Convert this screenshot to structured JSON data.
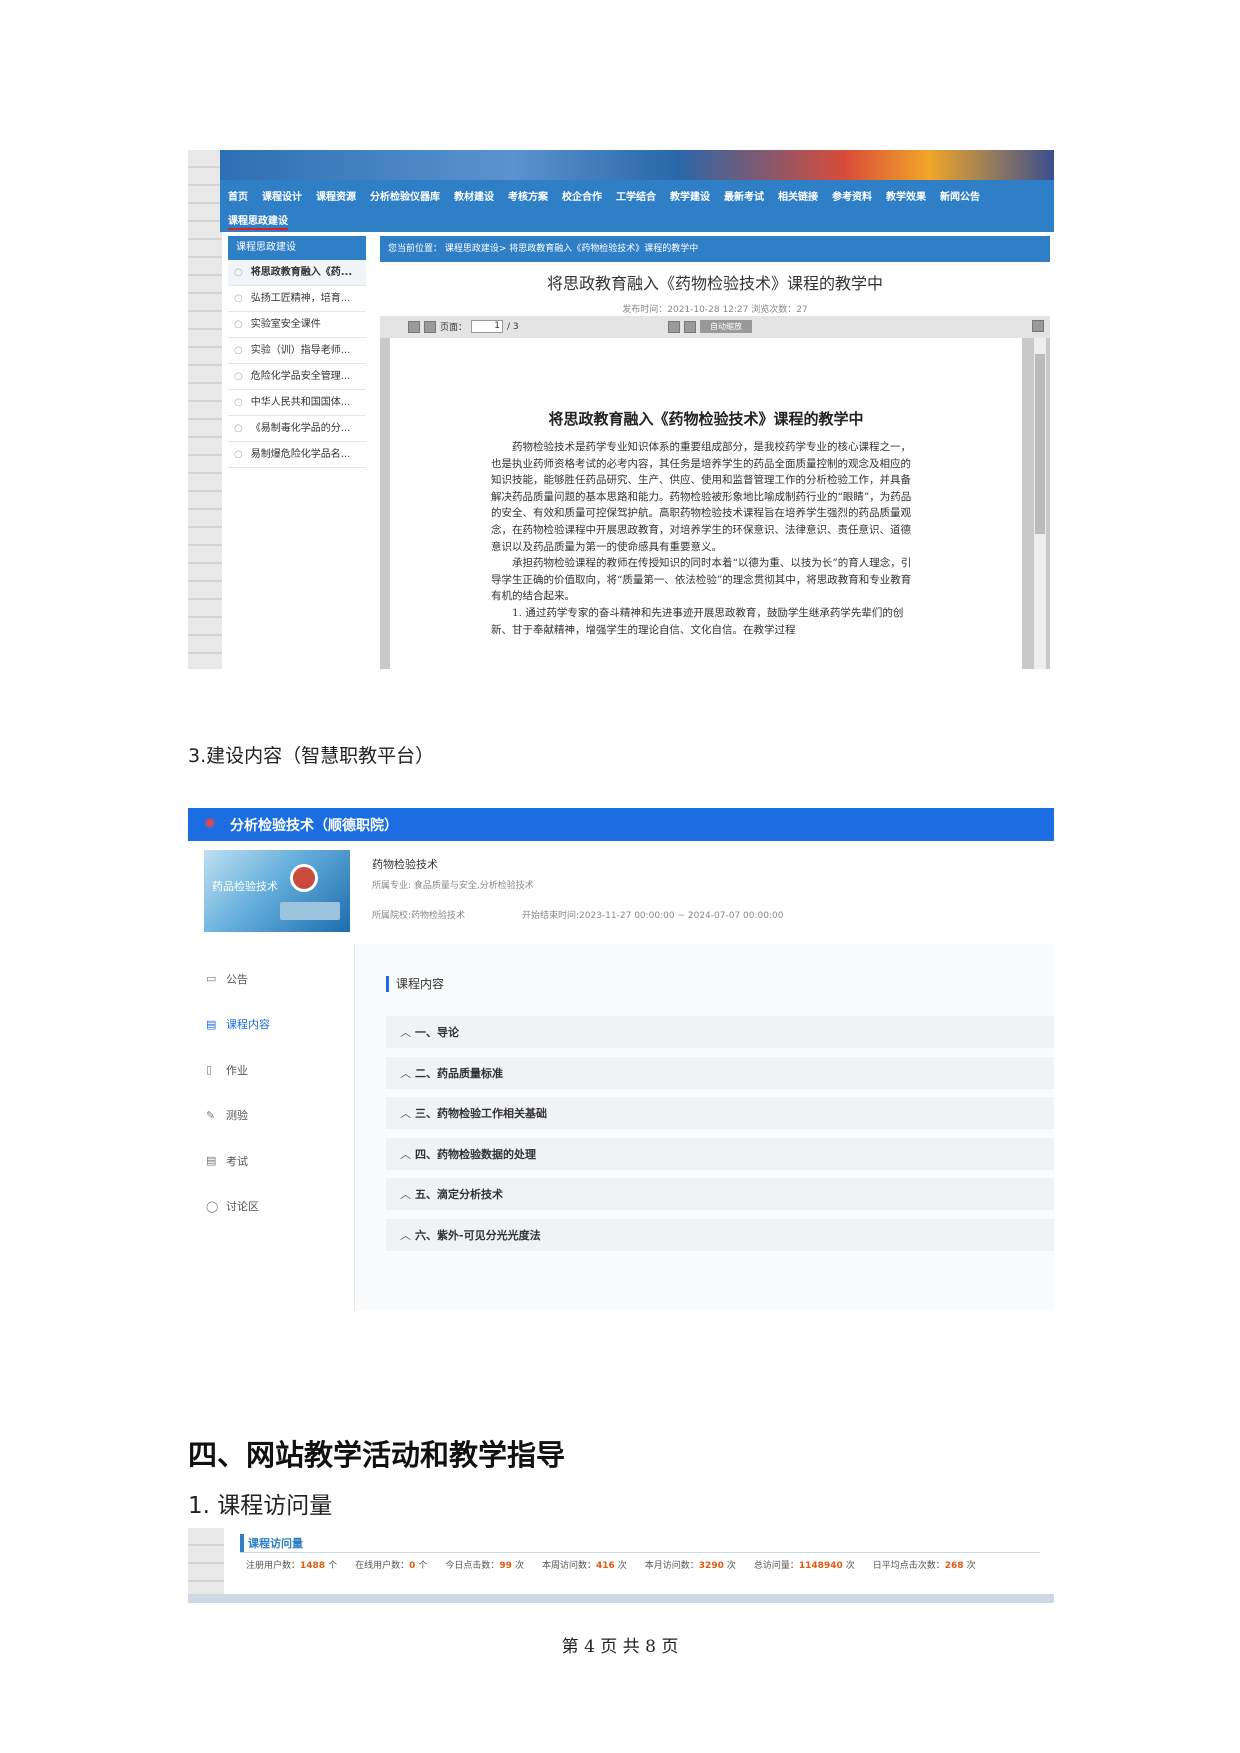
{
  "shot1": {
    "nav_items": [
      "首页",
      "课程设计",
      "课程资源",
      "分析检验仪器库",
      "教材建设",
      "考核方案",
      "校企合作",
      "工学结合",
      "教学建设",
      "最新考试",
      "相关链接",
      "参考资料",
      "教学效果",
      "新闻公告"
    ],
    "nav_sub": "课程思政建设",
    "side_header": "课程思政建设",
    "side_items": [
      "将思政教育融入《药...",
      "弘扬工匠精神，培育...",
      "实验室安全课件",
      "实验（训）指导老师...",
      "危险化学品安全管理...",
      "中华人民共和国国体...",
      "《易制毒化学品的分...",
      "易制爆危险化学品名..."
    ],
    "breadcrumb": "您当前位置： 课程思政建设> 将思政教育融入《药物检验技术》课程的教学中",
    "article_title": "将思政教育融入《药物检验技术》课程的教学中",
    "article_meta": "发布时间：2021-10-28 12:27 浏览次数：27",
    "viewer": {
      "page_label": "页面：",
      "page_current": "1",
      "page_total": "/ 3",
      "zoom_label": "自动缩放"
    },
    "doc_title": "将思政教育融入《药物检验技术》课程的教学中",
    "doc_paragraphs": [
      "药物检验技术是药学专业知识体系的重要组成部分，是我校药学专业的核心课程之一，也是执业药师资格考试的必考内容，其任务是培养学生的药品全面质量控制的观念及相应的知识技能，能够胜任药品研究、生产、供应、使用和监督管理工作的分析检验工作，并具备解决药品质量问题的基本思路和能力。药物检验被形象地比喻成制药行业的“眼睛”，为药品的安全、有效和质量可控保驾护航。高职药物检验技术课程旨在培养学生强烈的药品质量观念，在药物检验课程中开展思政教育，对培养学生的环保意识、法律意识、责任意识、道德意识以及药品质量为第一的使命感具有重要意义。",
      "承担药物检验课程的教师在传授知识的同时本着“以德为重、以技为长”的育人理念，引导学生正确的价值取向，将“质量第一、依法检验”的理念贯彻其中，将思政教育和专业教育有机的结合起来。",
      "1. 通过药学专家的奋斗精神和先进事迹开展思政教育，鼓励学生继承药学先辈们的创新、甘于奉献精神，增强学生的理论自信、文化自信。在教学过程"
    ]
  },
  "heading_build": "3.建设内容（智慧职教平台）",
  "shot2": {
    "app_title": "分析检验技术（顺德职院）",
    "cover_text": "药品检验技术",
    "course_name": "药物检验技术",
    "major": "所属专业: 食品质量与安全,分析检验技术",
    "school": "所属院校:药物检验技术",
    "time": "开始结束时间:2023-11-27 00:00:00 ~ 2024-07-07 00:00:00",
    "side_items": [
      {
        "icon": "▭",
        "label": "公告"
      },
      {
        "icon": "▤",
        "label": "课程内容"
      },
      {
        "icon": "▯",
        "label": "作业"
      },
      {
        "icon": "✎",
        "label": "测验"
      },
      {
        "icon": "▤",
        "label": "考试"
      },
      {
        "icon": "◯",
        "label": "讨论区"
      }
    ],
    "panel_header": "课程内容",
    "chapters": [
      "一、导论",
      "二、药品质量标准",
      "三、药物检验工作相关基础",
      "四、药物检验数据的处理",
      "五、滴定分析技术",
      "六、紫外-可见分光光度法"
    ]
  },
  "section_four": "四、网站教学活动和教学指导",
  "sub_one": "1.  课程访问量",
  "shot3": {
    "header": "课程访问量",
    "stats": [
      {
        "label": "注册用户数：",
        "value": "1488",
        "unit": "个"
      },
      {
        "label": "在线用户数：",
        "value": "0",
        "unit": "个"
      },
      {
        "label": "今日点击数：",
        "value": "99",
        "unit": "次"
      },
      {
        "label": "本周访问数：",
        "value": "416",
        "unit": "次"
      },
      {
        "label": "本月访问数：",
        "value": "3290",
        "unit": "次"
      },
      {
        "label": "总访问量：",
        "value": "1148940",
        "unit": "次"
      },
      {
        "label": "日平均点击次数：",
        "value": "268",
        "unit": "次"
      }
    ]
  },
  "footer": "第 4 页 共 8 页"
}
